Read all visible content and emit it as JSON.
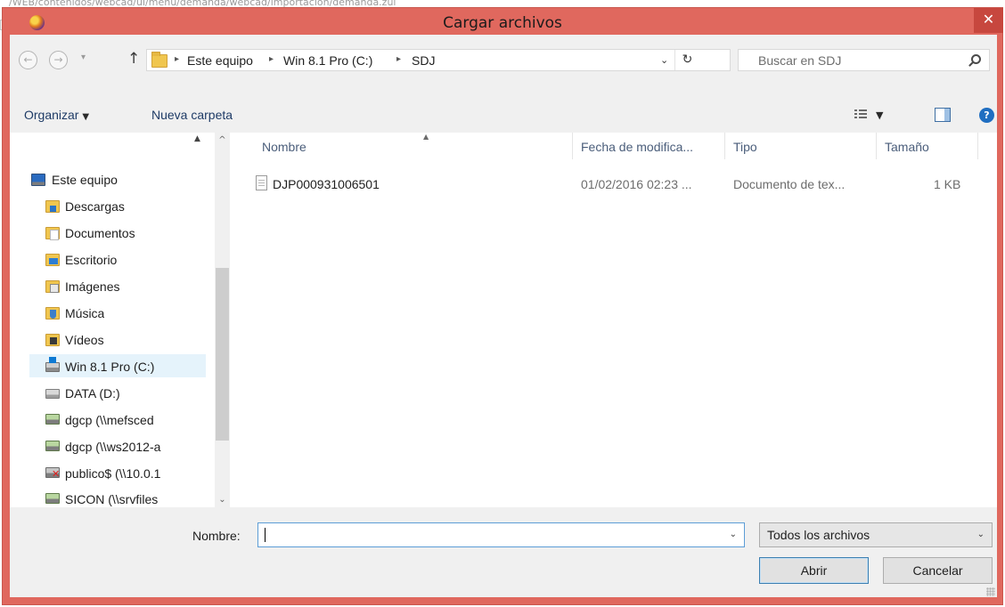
{
  "background_url": "/WEB/contenidos/webcad/ui/menu/demanda/webcad/importacion/demanda.zul",
  "window": {
    "title": "Cargar archivos",
    "close_glyph": "✕",
    "accent_color": "#e0685e"
  },
  "navigation": {
    "back_glyph": "←",
    "forward_glyph": "→",
    "recent_glyph": "▾",
    "up_glyph": "↑",
    "breadcrumb": [
      "Este equipo",
      "Win 8.1 Pro (C:)",
      "SDJ"
    ],
    "separator_glyph": "▸",
    "dropdown_glyph": "⌄",
    "refresh_glyph": "↻"
  },
  "search": {
    "placeholder": "Buscar en SDJ"
  },
  "toolbar": {
    "organize_label": "Organizar",
    "organize_caret": "▼",
    "new_folder_label": "Nueva carpeta",
    "view_caret": "▼",
    "help_glyph": "?"
  },
  "sidebar": {
    "expand_glyph": "▲",
    "items": [
      {
        "label": "Este equipo",
        "icon": "computer-icon"
      },
      {
        "label": "Descargas",
        "icon": "downloads-folder-icon"
      },
      {
        "label": "Documentos",
        "icon": "documents-folder-icon"
      },
      {
        "label": "Escritorio",
        "icon": "desktop-folder-icon"
      },
      {
        "label": "Imágenes",
        "icon": "pictures-folder-icon"
      },
      {
        "label": "Música",
        "icon": "music-folder-icon"
      },
      {
        "label": "Vídeos",
        "icon": "videos-folder-icon"
      },
      {
        "label": "Win 8.1 Pro (C:)",
        "icon": "windows-drive-icon",
        "selected": true
      },
      {
        "label": "DATA (D:)",
        "icon": "drive-icon"
      },
      {
        "label": "dgcp (\\\\mefsced",
        "icon": "network-drive-icon"
      },
      {
        "label": "dgcp (\\\\ws2012-a",
        "icon": "network-drive-icon"
      },
      {
        "label": "publico$ (\\\\10.0.1",
        "icon": "disconnected-network-drive-icon"
      },
      {
        "label": "SICON (\\\\srvfiles",
        "icon": "network-drive-icon"
      }
    ],
    "scroll_up_glyph": "^",
    "scroll_down_glyph": "⌄"
  },
  "filelist": {
    "columns": [
      "Nombre",
      "Fecha de modifica...",
      "Tipo",
      "Tamaño"
    ],
    "sort_glyph": "▲",
    "rows": [
      {
        "name": "DJP000931006501",
        "date": "01/02/2016 02:23 ...",
        "type": "Documento de tex...",
        "size": "1 KB"
      }
    ]
  },
  "footer": {
    "name_label": "Nombre:",
    "name_value": "",
    "combo_glyph": "⌄",
    "filter_value": "Todos los archivos",
    "open_label": "Abrir",
    "cancel_label": "Cancelar"
  }
}
